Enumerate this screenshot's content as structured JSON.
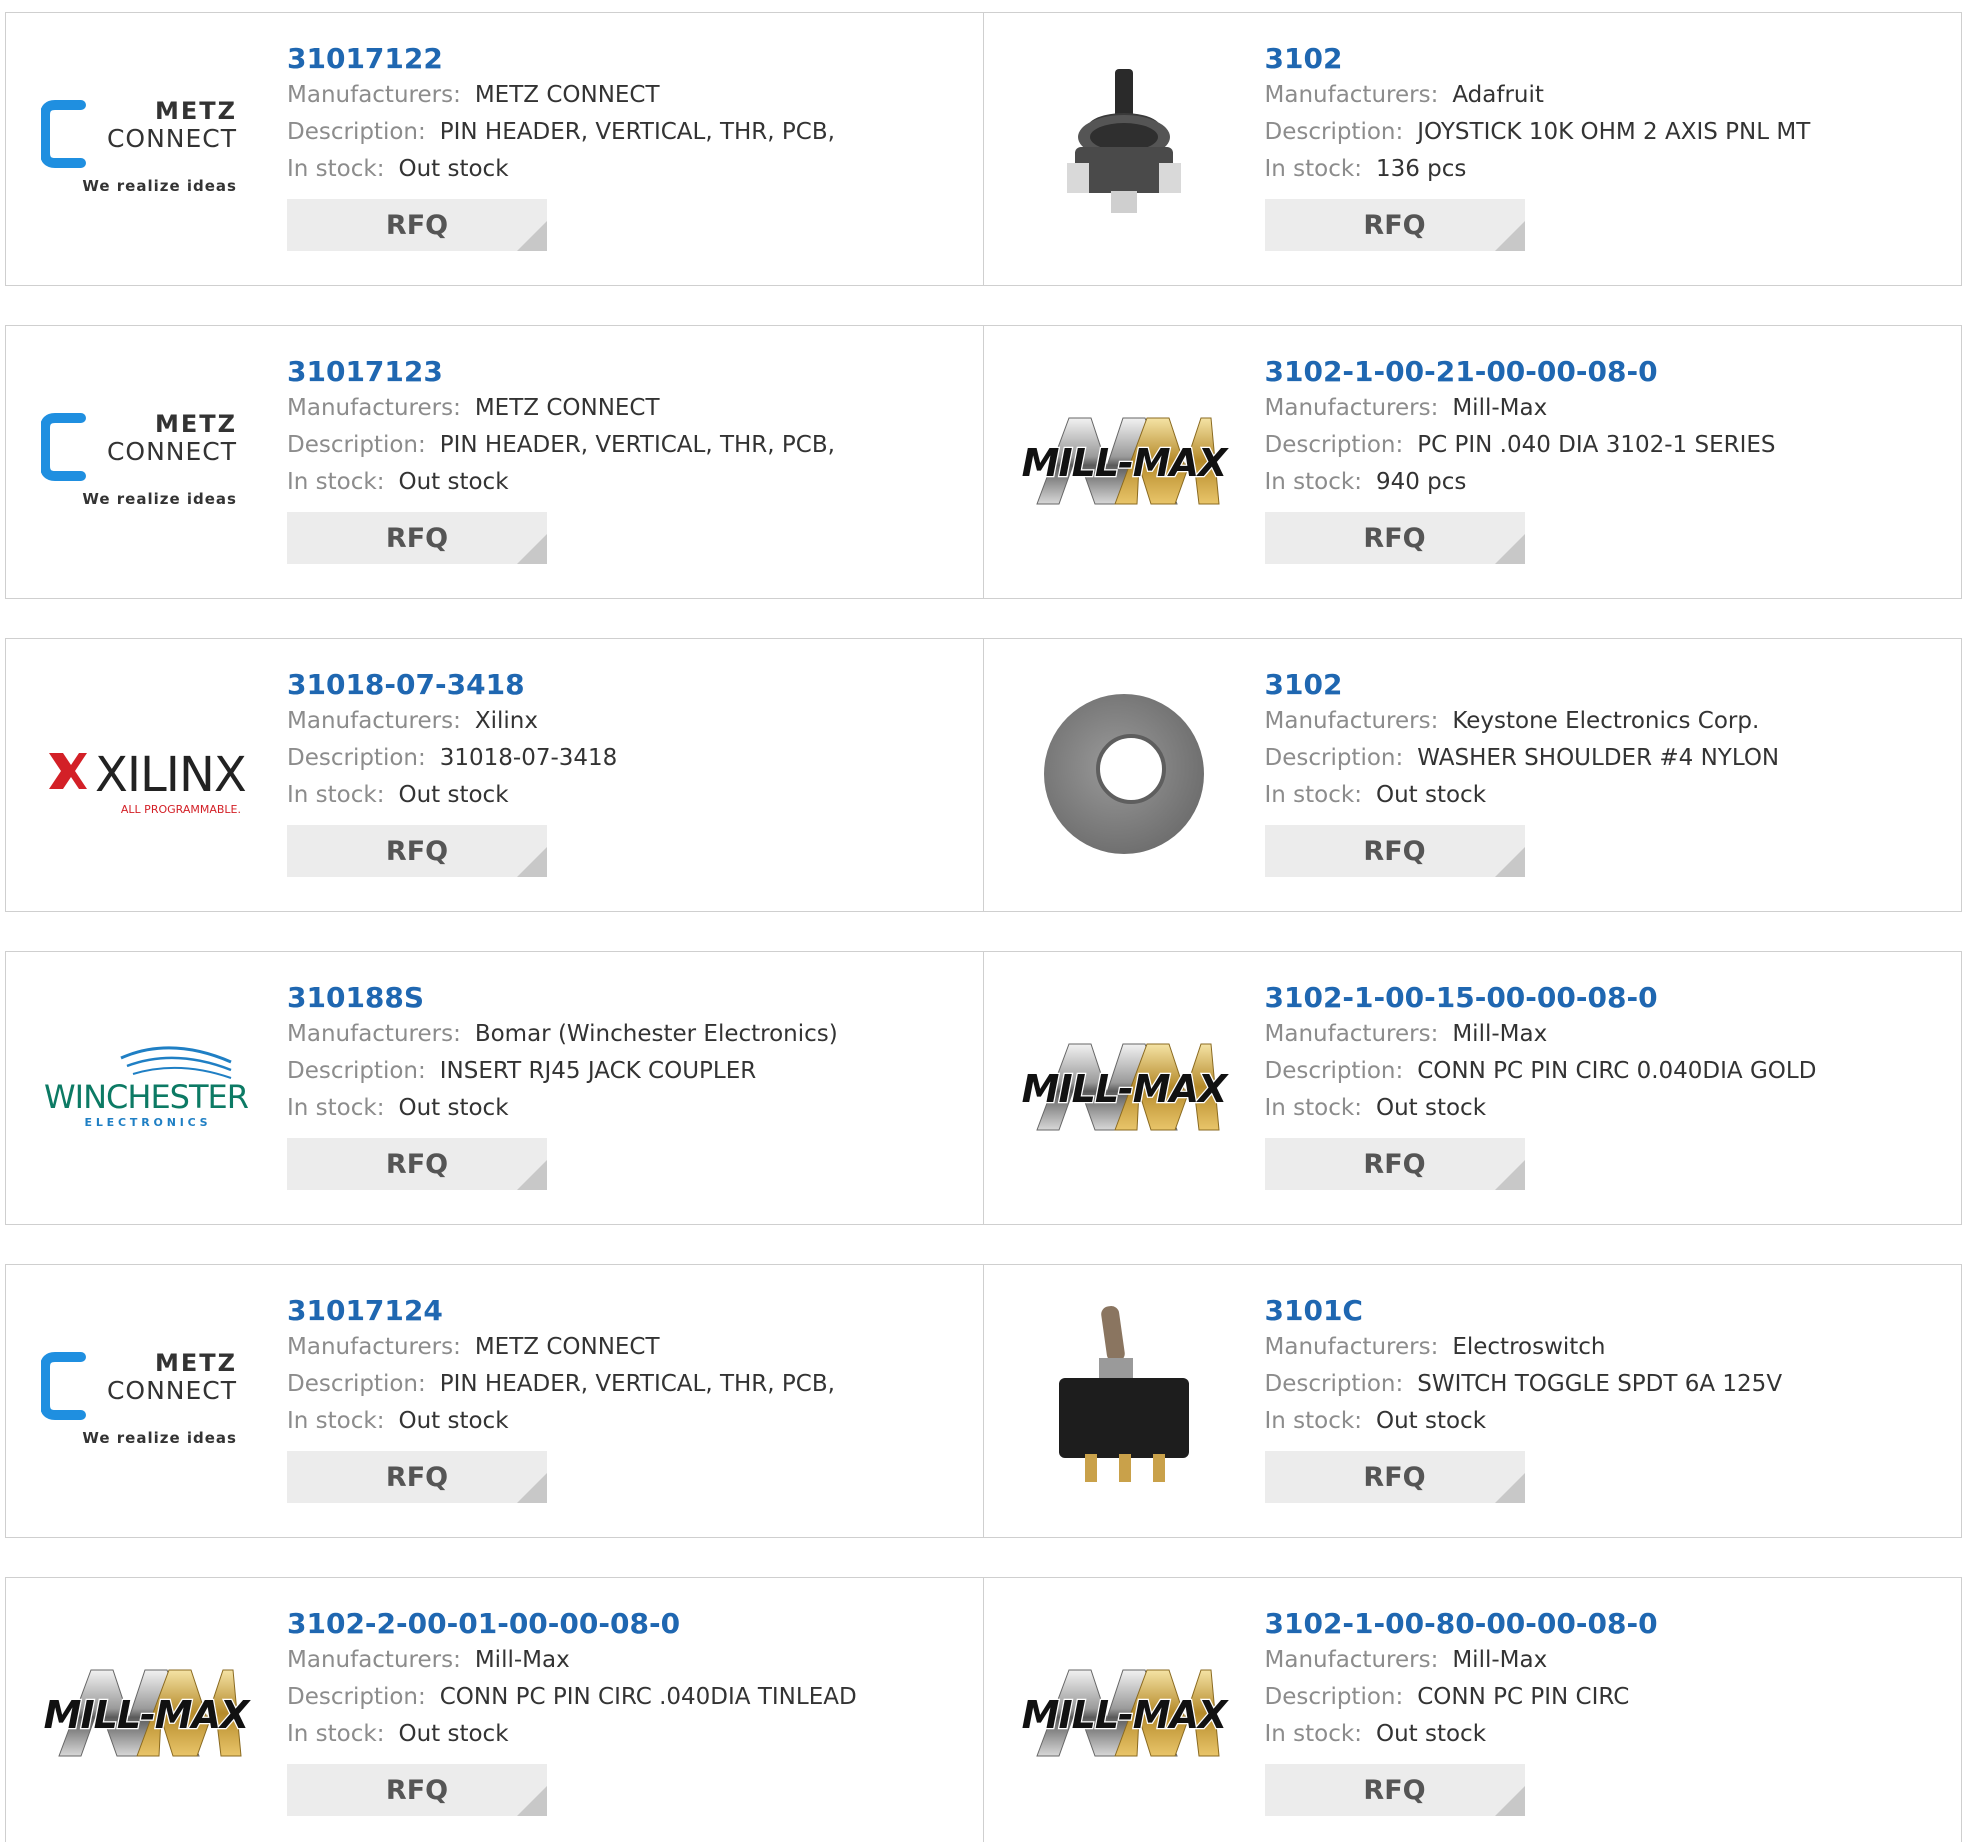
{
  "rfq_label": "RFQ",
  "labels": {
    "manufacturers": "Manufacturers:",
    "description": "Description:",
    "in_stock": "In stock:"
  },
  "logos": {
    "metz": {
      "line1": "METZ",
      "line2": "CONNECT",
      "tagline": "We realize ideas"
    },
    "xilinx": {
      "name": "XILINX",
      "tagline": "ALL PROGRAMMABLE."
    },
    "winchester": {
      "name": "WINCHESTER",
      "tagline": "E L E C T R O N I C S"
    },
    "millmax": {
      "name": "MILL-MAX"
    }
  },
  "products": [
    {
      "part": "31017122",
      "manufacturer": "METZ CONNECT",
      "description": "PIN HEADER, VERTICAL, THR, PCB,",
      "stock": "Out stock",
      "image": "metz-logo"
    },
    {
      "part": "3102",
      "manufacturer": "Adafruit",
      "description": "JOYSTICK 10K OHM 2 AXIS PNL MT",
      "stock": "136 pcs",
      "image": "joystick-image"
    },
    {
      "part": "31017123",
      "manufacturer": "METZ CONNECT",
      "description": "PIN HEADER, VERTICAL, THR, PCB,",
      "stock": "Out stock",
      "image": "metz-logo"
    },
    {
      "part": "3102-1-00-21-00-00-08-0",
      "manufacturer": "Mill-Max",
      "description": "PC PIN .040 DIA 3102-1 SERIES",
      "stock": "940 pcs",
      "image": "millmax-logo"
    },
    {
      "part": "31018-07-3418",
      "manufacturer": "Xilinx",
      "description": "31018-07-3418",
      "stock": "Out stock",
      "image": "xilinx-logo"
    },
    {
      "part": "3102",
      "manufacturer": "Keystone Electronics Corp.",
      "description": "WASHER SHOULDER #4 NYLON",
      "stock": "Out stock",
      "image": "washer-image"
    },
    {
      "part": "310188S",
      "manufacturer": "Bomar (Winchester Electronics)",
      "description": "INSERT RJ45 JACK COUPLER",
      "stock": "Out stock",
      "image": "winchester-logo"
    },
    {
      "part": "3102-1-00-15-00-00-08-0",
      "manufacturer": "Mill-Max",
      "description": "CONN PC PIN CIRC 0.040DIA GOLD",
      "stock": "Out stock",
      "image": "millmax-logo"
    },
    {
      "part": "31017124",
      "manufacturer": "METZ CONNECT",
      "description": "PIN HEADER, VERTICAL, THR, PCB,",
      "stock": "Out stock",
      "image": "metz-logo"
    },
    {
      "part": "3101C",
      "manufacturer": "Electroswitch",
      "description": "SWITCH TOGGLE SPDT 6A 125V",
      "stock": "Out stock",
      "image": "toggle-switch-image"
    },
    {
      "part": "3102-2-00-01-00-00-08-0",
      "manufacturer": "Mill-Max",
      "description": "CONN PC PIN CIRC .040DIA TINLEAD",
      "stock": "Out stock",
      "image": "millmax-logo"
    },
    {
      "part": "3102-1-00-80-00-00-08-0",
      "manufacturer": "Mill-Max",
      "description": "CONN PC PIN CIRC",
      "stock": "Out stock",
      "image": "millmax-logo"
    }
  ]
}
